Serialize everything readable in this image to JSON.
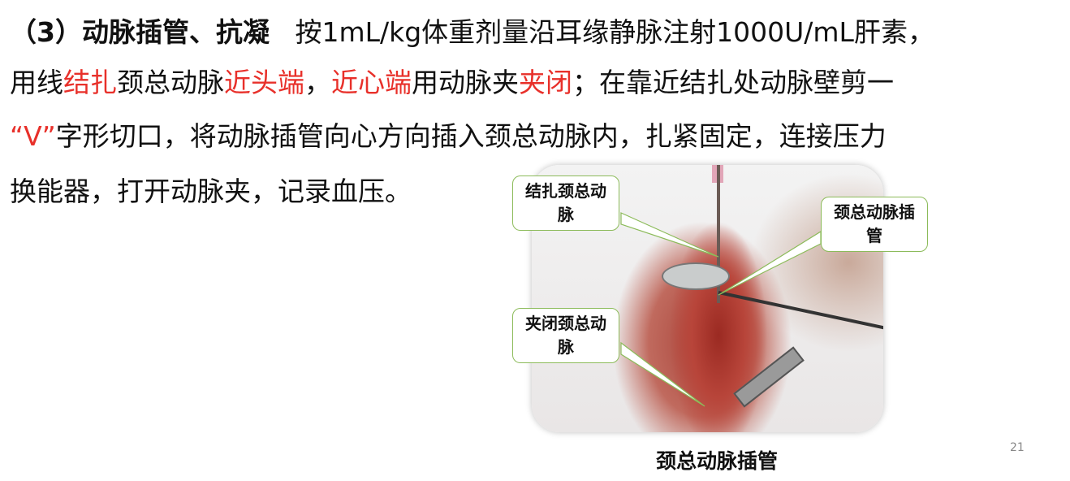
{
  "slide": {
    "line1": {
      "heading": "（3）动脉插管、抗凝",
      "text": "按1mL/kg体重剂量沿耳缘静脉注射1000U/mL肝素，"
    },
    "line2": [
      {
        "t": "用线",
        "red": false
      },
      {
        "t": "结扎",
        "red": true
      },
      {
        "t": "颈总动脉",
        "red": false
      },
      {
        "t": "近头端",
        "red": true
      },
      {
        "t": "，",
        "red": false
      },
      {
        "t": "近心端",
        "red": true
      },
      {
        "t": "用动脉夹",
        "red": false
      },
      {
        "t": "夹闭",
        "red": true
      },
      {
        "t": "；在靠近结扎处动脉壁剪一",
        "red": false
      }
    ],
    "line3": {
      "quote": "“V”",
      "text": "字形切口，将动脉插管向心方向插入颈总动脉内，扎紧固定，连接压力"
    },
    "line4": "换能器，打开动脉夹，记录血压。",
    "callouts": {
      "ligate": "结扎颈总动脉",
      "cannula": "颈总动脉插管",
      "clamp": "夹闭颈总动脉"
    },
    "caption": "颈总动脉插管",
    "page_number": "21",
    "accent_color": "#e8302a"
  }
}
